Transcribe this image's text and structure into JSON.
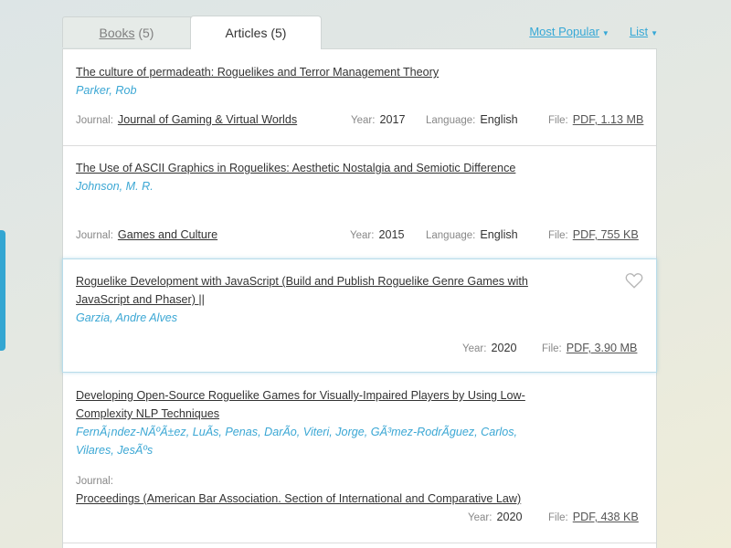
{
  "tabs": {
    "books": {
      "label": "Books",
      "count": "(5)"
    },
    "articles": {
      "label": "Articles (5)"
    }
  },
  "sort": {
    "popular": "Most Popular",
    "view": "List"
  },
  "labels": {
    "journal": "Journal:",
    "year": "Year:",
    "language": "Language:",
    "file": "File:"
  },
  "articles": [
    {
      "title": "The culture of permadeath: Roguelikes and Terror Management Theory",
      "authors": "Parker, Rob",
      "journal": "Journal of Gaming & Virtual Worlds",
      "year": "2017",
      "language": "English",
      "file": "PDF, 1.13 MB"
    },
    {
      "title": "The Use of ASCII Graphics in Roguelikes: Aesthetic Nostalgia and Semiotic Difference",
      "authors": "Johnson, M. R.",
      "journal": "Games and Culture",
      "year": "2015",
      "language": "English",
      "file": "PDF, 755 KB"
    },
    {
      "title": "Roguelike Development with JavaScript (Build and Publish Roguelike Genre Games with JavaScript and Phaser) ||",
      "authors": "Garzia, Andre Alves",
      "year": "2020",
      "file": "PDF, 3.90 MB"
    },
    {
      "title": "Developing Open-Source Roguelike Games for Visually-Impaired Players by Using Low-Complexity NLP Techniques",
      "authors": "FernÃ¡ndez-NÃºÃ±ez, LuÃs, Penas, DarÃo, Viteri, Jorge, GÃ³mez-RodrÃguez, Carlos, Vilares, JesÃºs",
      "journal": "Proceedings (American Bar Association. Section of International and Comparative Law)",
      "year": "2020",
      "file": "PDF, 438 KB"
    }
  ],
  "colors": {
    "accent": "#36a8d6",
    "text": "#333333"
  }
}
